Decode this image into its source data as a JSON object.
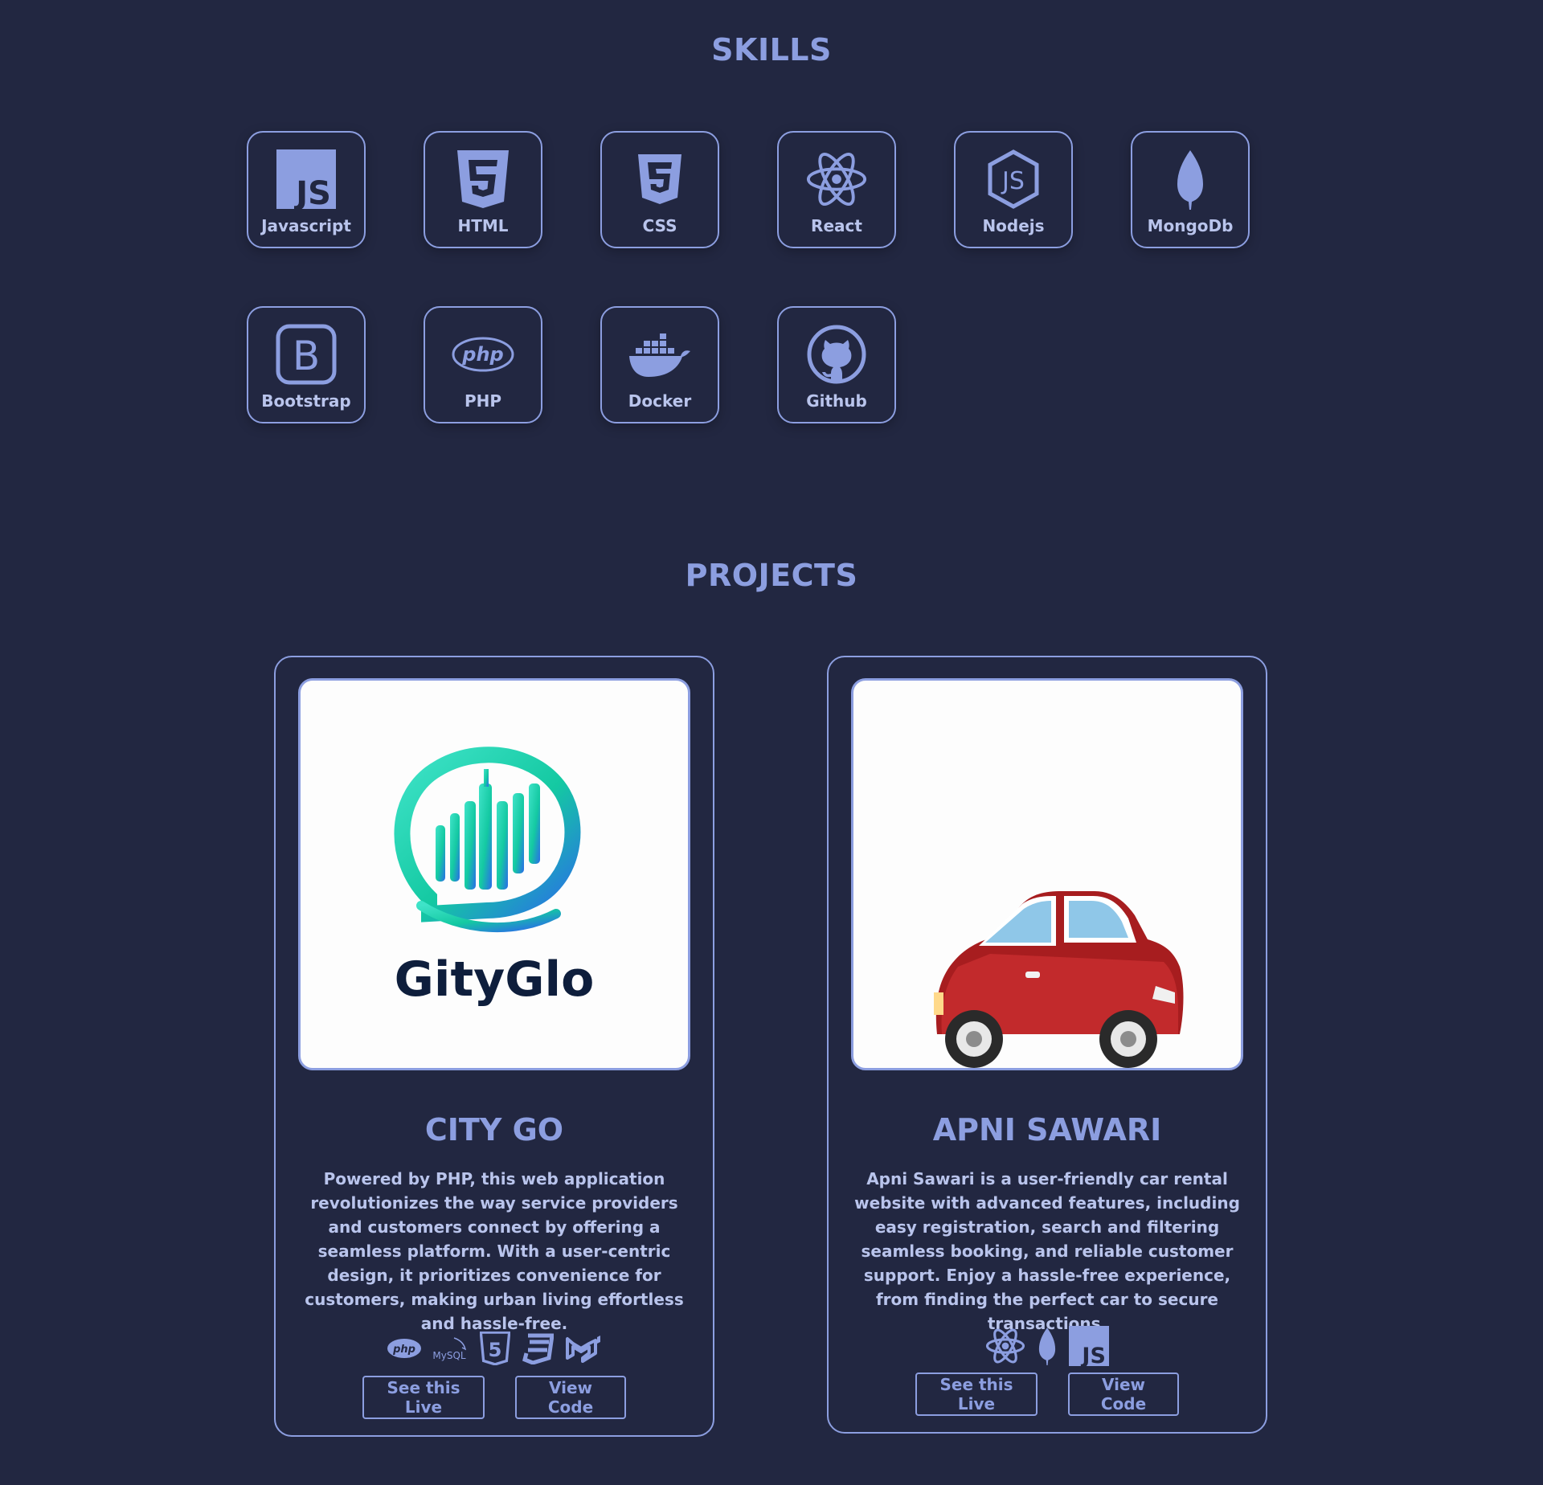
{
  "skills": {
    "title": "SKILLS",
    "items": [
      {
        "label": "Javascript",
        "icon": "javascript-icon"
      },
      {
        "label": "HTML",
        "icon": "html5-icon"
      },
      {
        "label": "CSS",
        "icon": "css3-icon"
      },
      {
        "label": "React",
        "icon": "react-icon"
      },
      {
        "label": "Nodejs",
        "icon": "nodejs-icon"
      },
      {
        "label": "MongoDb",
        "icon": "mongodb-icon"
      },
      {
        "label": "Bootstrap",
        "icon": "bootstrap-icon"
      },
      {
        "label": "PHP",
        "icon": "php-icon"
      },
      {
        "label": "Docker",
        "icon": "docker-icon"
      },
      {
        "label": "Github",
        "icon": "github-icon"
      }
    ]
  },
  "projects": {
    "title": "PROJECTS",
    "items": [
      {
        "title": "CITY GO",
        "image_logo_text": "GityGlo",
        "description": "Powered by PHP, this web application revolutionizes the way service providers and customers connect by offering a seamless platform. With a user-centric design, it prioritizes convenience for customers, making urban living effortless and hassle-free.",
        "tech_icons": [
          "php-icon",
          "mysql-icon",
          "html5-icon",
          "css3-icon",
          "material-ui-icon"
        ],
        "mysql_label": "MySQL",
        "php_label": "php",
        "live_label": "See this Live",
        "code_label": "View Code"
      },
      {
        "title": "APNI SAWARI",
        "description": "Apni Sawari is a user-friendly car rental website with advanced features, including easy registration, search and filtering seamless booking, and reliable customer support. Enjoy a hassle-free experience, from finding the perfect car to secure transactions.",
        "tech_icons": [
          "react-icon",
          "mongodb-icon",
          "javascript-icon"
        ],
        "live_label": "See this Live",
        "code_label": "View Code"
      }
    ]
  },
  "colors": {
    "background": "#222741",
    "accent": "#8c9ee0",
    "text_light": "#b9c4ec"
  }
}
